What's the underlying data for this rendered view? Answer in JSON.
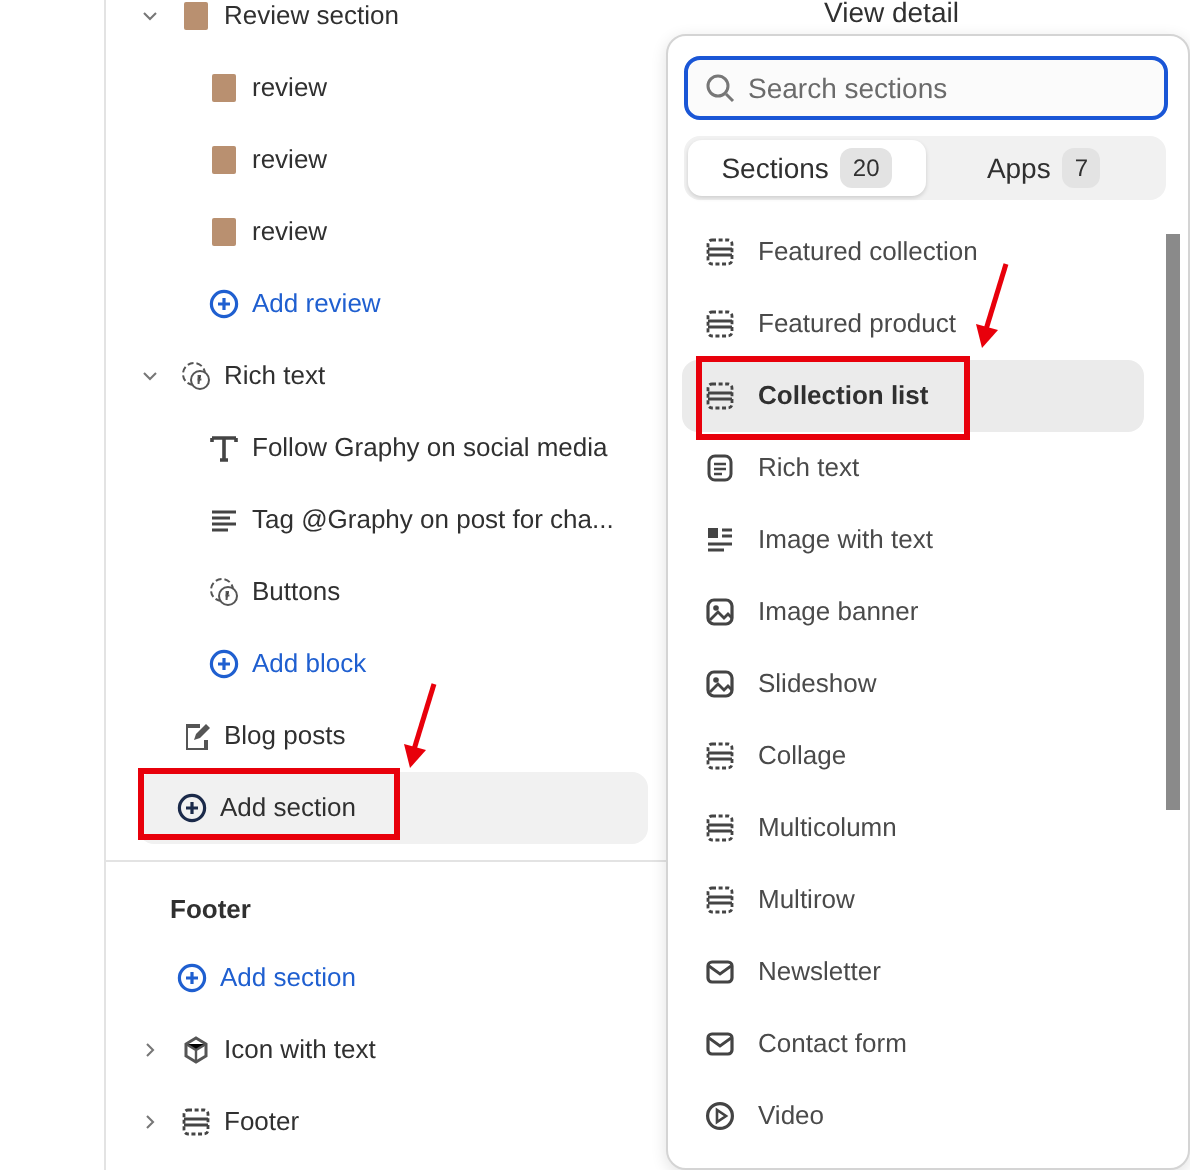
{
  "top_text": "View detail",
  "tree": [
    {
      "label": "Review section",
      "expanded": true,
      "children": [
        {
          "label": "review"
        },
        {
          "label": "review"
        },
        {
          "label": "review"
        },
        {
          "label": "Add review",
          "kind": "add"
        }
      ]
    },
    {
      "label": "Rich text",
      "expanded": true,
      "children": [
        {
          "label": "Follow Graphy on social media"
        },
        {
          "label": "Tag @Graphy on post for cha..."
        },
        {
          "label": "Buttons"
        },
        {
          "label": "Add block",
          "kind": "add"
        }
      ]
    },
    {
      "label": "Blog posts"
    },
    {
      "label": "Add section",
      "kind": "add-section",
      "highlighted": true,
      "annotated": true
    }
  ],
  "footer": {
    "heading": "Footer",
    "items": [
      {
        "label": "Add section",
        "kind": "add"
      },
      {
        "label": "Icon with text",
        "expanded": false
      },
      {
        "label": "Footer",
        "expanded": false
      }
    ]
  },
  "picker": {
    "search": {
      "placeholder": "Search sections"
    },
    "tabs": [
      {
        "label": "Sections",
        "count": "20",
        "selected": true
      },
      {
        "label": "Apps",
        "count": "7",
        "selected": false
      }
    ],
    "items": [
      {
        "label": "Featured collection",
        "selected": false
      },
      {
        "label": "Featured product",
        "selected": false
      },
      {
        "label": "Collection list",
        "selected": true,
        "annotated": true
      },
      {
        "label": "Rich text",
        "selected": false
      },
      {
        "label": "Image with text",
        "selected": false
      },
      {
        "label": "Image banner",
        "selected": false
      },
      {
        "label": "Slideshow",
        "selected": false
      },
      {
        "label": "Collage",
        "selected": false
      },
      {
        "label": "Multicolumn",
        "selected": false
      },
      {
        "label": "Multirow",
        "selected": false
      },
      {
        "label": "Newsletter",
        "selected": false
      },
      {
        "label": "Contact form",
        "selected": false
      },
      {
        "label": "Video",
        "selected": false
      }
    ]
  }
}
